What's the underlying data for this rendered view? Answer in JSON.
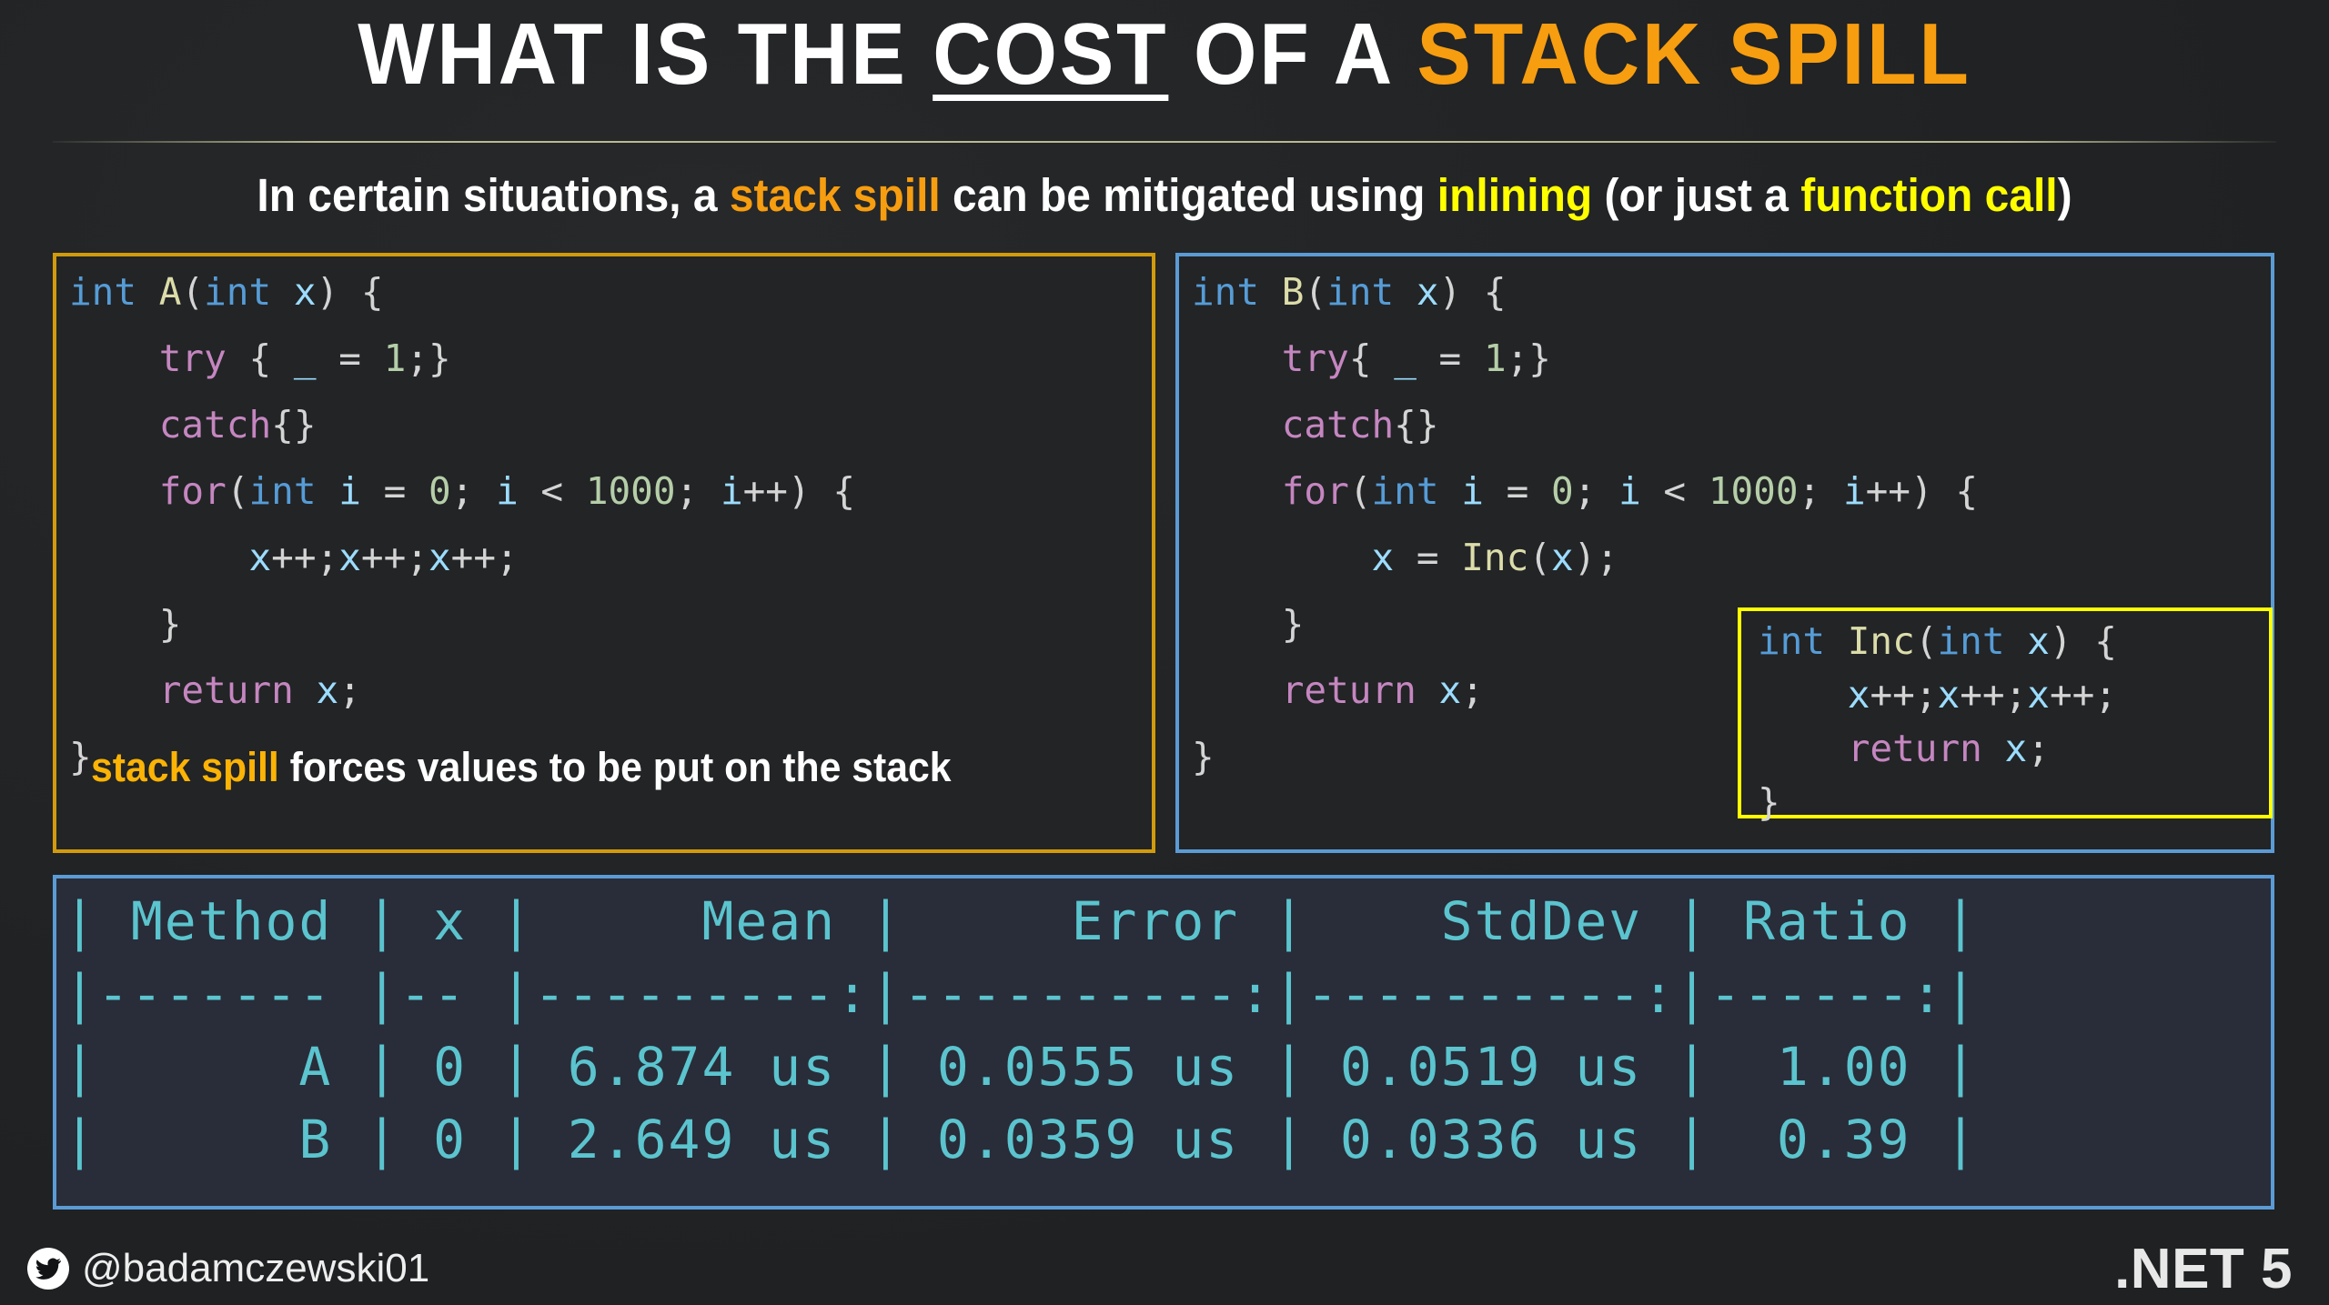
{
  "title": {
    "part1": "WHAT IS THE ",
    "underlined": "COST",
    "part2": " OF A ",
    "accent": "STACK SPILL"
  },
  "subtitle": {
    "p1": "In certain situations, a ",
    "orange1": "stack spill",
    "p2": " can be mitigated using ",
    "yellow1": "inlining",
    "p3": " (or just a ",
    "yellow2": "function call",
    "p4": ")"
  },
  "code_left": {
    "lines": [
      [
        [
          "int",
          "t-type"
        ],
        [
          " ",
          "t-punc"
        ],
        [
          "A",
          "t-fn"
        ],
        [
          "(",
          "t-punc"
        ],
        [
          "int",
          "t-type"
        ],
        [
          " ",
          "t-punc"
        ],
        [
          "x",
          "t-var"
        ],
        [
          ") {",
          "t-punc"
        ]
      ],
      [
        [
          "    ",
          "t-punc"
        ],
        [
          "try",
          "t-kw"
        ],
        [
          " { ",
          "t-punc"
        ],
        [
          "_",
          "t-var"
        ],
        [
          " = ",
          "t-punc"
        ],
        [
          "1",
          "t-num"
        ],
        [
          ";}",
          "t-punc"
        ]
      ],
      [
        [
          "    ",
          "t-punc"
        ],
        [
          "catch",
          "t-kw"
        ],
        [
          "{}",
          "t-punc"
        ]
      ],
      [
        [
          "    ",
          "t-punc"
        ],
        [
          "for",
          "t-kw"
        ],
        [
          "(",
          "t-punc"
        ],
        [
          "int",
          "t-type"
        ],
        [
          " ",
          "t-punc"
        ],
        [
          "i",
          "t-var"
        ],
        [
          " = ",
          "t-punc"
        ],
        [
          "0",
          "t-num"
        ],
        [
          "; ",
          "t-punc"
        ],
        [
          "i",
          "t-var"
        ],
        [
          " < ",
          "t-punc"
        ],
        [
          "1000",
          "t-num"
        ],
        [
          "; ",
          "t-punc"
        ],
        [
          "i",
          "t-var"
        ],
        [
          "++) {",
          "t-punc"
        ]
      ],
      [
        [
          "        ",
          "t-punc"
        ],
        [
          "x",
          "t-var"
        ],
        [
          "++;",
          "t-punc"
        ],
        [
          "x",
          "t-var"
        ],
        [
          "++;",
          "t-punc"
        ],
        [
          "x",
          "t-var"
        ],
        [
          "++;",
          "t-punc"
        ]
      ],
      [
        [
          "    }",
          "t-punc"
        ]
      ],
      [
        [
          "    ",
          "t-punc"
        ],
        [
          "return",
          "t-kw"
        ],
        [
          " ",
          "t-punc"
        ],
        [
          "x",
          "t-var"
        ],
        [
          ";",
          "t-punc"
        ]
      ],
      [
        [
          "}",
          "t-punc"
        ]
      ]
    ],
    "caption_orange": "stack spill",
    "caption_rest": " forces values to be put on the stack"
  },
  "code_right": {
    "lines": [
      [
        [
          "int",
          "t-type"
        ],
        [
          " ",
          "t-punc"
        ],
        [
          "B",
          "t-fn"
        ],
        [
          "(",
          "t-punc"
        ],
        [
          "int",
          "t-type"
        ],
        [
          " ",
          "t-punc"
        ],
        [
          "x",
          "t-var"
        ],
        [
          ") {",
          "t-punc"
        ]
      ],
      [
        [
          "    ",
          "t-punc"
        ],
        [
          "try",
          "t-kw"
        ],
        [
          "{ ",
          "t-punc"
        ],
        [
          "_",
          "t-var"
        ],
        [
          " = ",
          "t-punc"
        ],
        [
          "1",
          "t-num"
        ],
        [
          ";}",
          "t-punc"
        ]
      ],
      [
        [
          "    ",
          "t-punc"
        ],
        [
          "catch",
          "t-kw"
        ],
        [
          "{}",
          "t-punc"
        ]
      ],
      [
        [
          "    ",
          "t-punc"
        ],
        [
          "for",
          "t-kw"
        ],
        [
          "(",
          "t-punc"
        ],
        [
          "int",
          "t-type"
        ],
        [
          " ",
          "t-punc"
        ],
        [
          "i",
          "t-var"
        ],
        [
          " = ",
          "t-punc"
        ],
        [
          "0",
          "t-num"
        ],
        [
          "; ",
          "t-punc"
        ],
        [
          "i",
          "t-var"
        ],
        [
          " < ",
          "t-punc"
        ],
        [
          "1000",
          "t-num"
        ],
        [
          "; ",
          "t-punc"
        ],
        [
          "i",
          "t-var"
        ],
        [
          "++) {",
          "t-punc"
        ]
      ],
      [
        [
          "        ",
          "t-punc"
        ],
        [
          "x",
          "t-var"
        ],
        [
          " = ",
          "t-punc"
        ],
        [
          "Inc",
          "t-fn"
        ],
        [
          "(",
          "t-punc"
        ],
        [
          "x",
          "t-var"
        ],
        [
          ");",
          "t-punc"
        ]
      ],
      [
        [
          "    }",
          "t-punc"
        ]
      ],
      [
        [
          "    ",
          "t-punc"
        ],
        [
          "return",
          "t-kw"
        ],
        [
          " ",
          "t-punc"
        ],
        [
          "x",
          "t-var"
        ],
        [
          ";",
          "t-punc"
        ]
      ],
      [
        [
          "}",
          "t-punc"
        ]
      ]
    ]
  },
  "code_inc": {
    "lines": [
      [
        [
          "int",
          "t-type"
        ],
        [
          " ",
          "t-punc"
        ],
        [
          "Inc",
          "t-fn"
        ],
        [
          "(",
          "t-punc"
        ],
        [
          "int",
          "t-type"
        ],
        [
          " ",
          "t-punc"
        ],
        [
          "x",
          "t-var"
        ],
        [
          ") {",
          "t-punc"
        ]
      ],
      [
        [
          "    ",
          "t-punc"
        ],
        [
          "x",
          "t-var"
        ],
        [
          "++;",
          "t-punc"
        ],
        [
          "x",
          "t-var"
        ],
        [
          "++;",
          "t-punc"
        ],
        [
          "x",
          "t-var"
        ],
        [
          "++;",
          "t-punc"
        ]
      ],
      [
        [
          "    ",
          "t-punc"
        ],
        [
          "return",
          "t-kw"
        ],
        [
          " ",
          "t-punc"
        ],
        [
          "x",
          "t-var"
        ],
        [
          ";",
          "t-punc"
        ]
      ],
      [
        [
          "}",
          "t-punc"
        ]
      ]
    ]
  },
  "benchmark": {
    "columns": [
      "Method",
      "x",
      "Mean",
      "Error",
      "StdDev",
      "Ratio"
    ],
    "rows": [
      {
        "Method": "A",
        "x": "0",
        "Mean": "6.874 us",
        "Error": "0.0555 us",
        "StdDev": "0.0519 us",
        "Ratio": "1.00"
      },
      {
        "Method": "B",
        "x": "0",
        "Mean": "2.649 us",
        "Error": "0.0359 us",
        "StdDev": "0.0336 us",
        "Ratio": "0.39"
      }
    ],
    "text_lines": [
      "| Method | x |     Mean |     Error |    StdDev | Ratio |",
      "|------- |-- |---------:|----------:|----------:|------:|",
      "|      A | 0 | 6.874 us | 0.0555 us | 0.0519 us |  1.00 |",
      "|      B | 0 | 2.649 us | 0.0359 us | 0.0336 us |  0.39 |"
    ]
  },
  "footer": {
    "twitter_handle": "@badamczewski01",
    "platform": ".NET 5"
  },
  "colors": {
    "background": "#222426",
    "accent_orange": "#f79d10",
    "accent_yellow": "#ffff00",
    "border_gold": "#d29b0c",
    "border_blue": "#5b9bd5",
    "table_text": "#5bc4ce",
    "table_bg": "#282d39"
  }
}
